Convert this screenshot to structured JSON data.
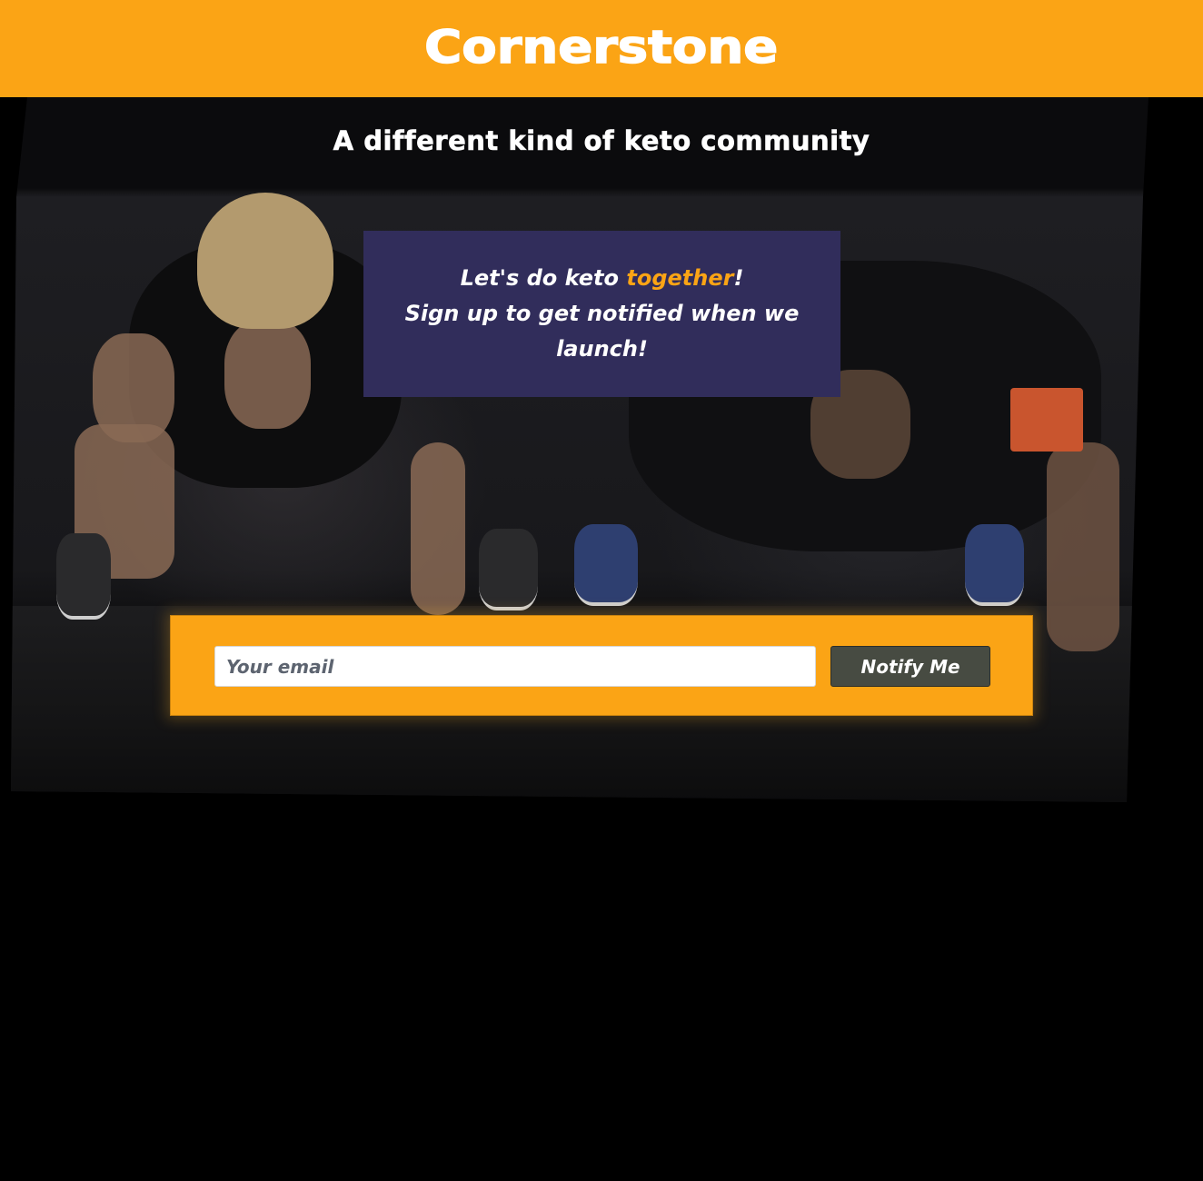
{
  "header": {
    "brand": "Cornerstone"
  },
  "hero": {
    "tagline": "A different kind of keto community",
    "background_image": "push-up-workout-photo"
  },
  "notice": {
    "line1_prefix": "Let's do keto ",
    "line1_highlight": "together",
    "line1_suffix": "!",
    "line2": "Sign up to get notified when we launch!"
  },
  "signup": {
    "email_placeholder": "Your email",
    "email_value": "",
    "button_label": "Notify Me"
  },
  "colors": {
    "accent": "#fba415",
    "notice_bg": "#312d5b",
    "button_bg": "#474b42",
    "page_bg": "#000000"
  }
}
